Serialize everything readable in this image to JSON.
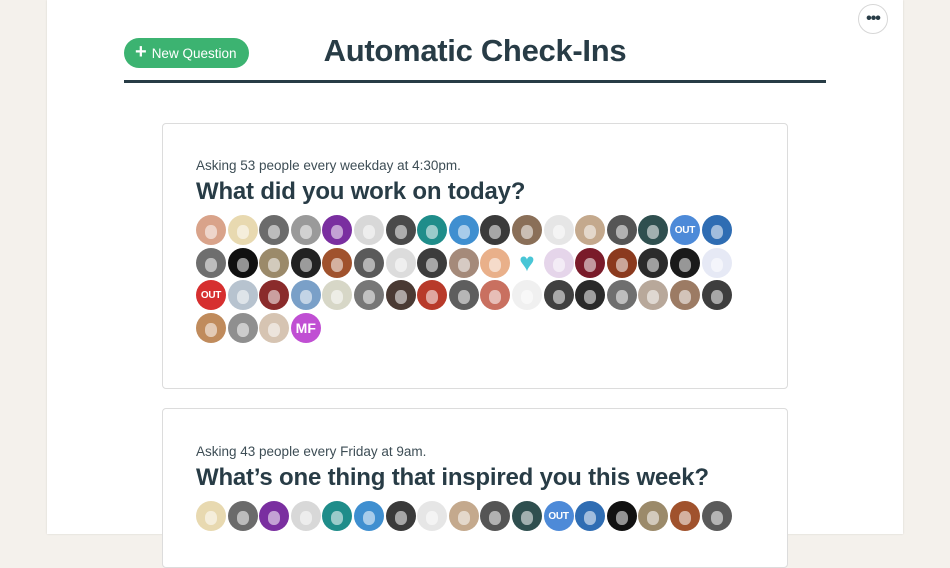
{
  "page": {
    "title": "Automatic Check-Ins",
    "new_question_label": "New Question",
    "more_label": "•••"
  },
  "colors": {
    "accent_green": "#3cb371",
    "title_ink": "#283c46",
    "initials_purple": "#c04fd3"
  },
  "checkins": [
    {
      "asking": "Asking 53 people every weekday at 4:30pm.",
      "question": "What did you work on today?",
      "avatars": [
        {
          "kind": "photo",
          "color": "#d9a38a"
        },
        {
          "kind": "photo",
          "color": "#e8d9b0"
        },
        {
          "kind": "photo",
          "color": "#6b6b6b"
        },
        {
          "kind": "photo",
          "color": "#9a9a9a"
        },
        {
          "kind": "photo",
          "color": "#7a2fa0"
        },
        {
          "kind": "photo",
          "color": "#d8d8d8"
        },
        {
          "kind": "photo",
          "color": "#4a4a4a"
        },
        {
          "kind": "photo",
          "color": "#1f8d8a"
        },
        {
          "kind": "photo",
          "color": "#3f8fd0"
        },
        {
          "kind": "photo",
          "color": "#3a3a3a"
        },
        {
          "kind": "photo",
          "color": "#8a6f58"
        },
        {
          "kind": "photo",
          "color": "#e6e6e6"
        },
        {
          "kind": "photo",
          "color": "#c4a98d"
        },
        {
          "kind": "photo",
          "color": "#555555"
        },
        {
          "kind": "photo",
          "color": "#2f4f4f"
        },
        {
          "kind": "out",
          "color": "#4d8ad8",
          "label": "OUT"
        },
        {
          "kind": "photo",
          "color": "#2f6db3"
        },
        {
          "kind": "photo",
          "color": "#6e6e6e"
        },
        {
          "kind": "photo",
          "color": "#111111"
        },
        {
          "kind": "photo",
          "color": "#9b8a6a"
        },
        {
          "kind": "photo",
          "color": "#222222"
        },
        {
          "kind": "photo",
          "color": "#a0522d"
        },
        {
          "kind": "photo",
          "color": "#5a5a5a"
        },
        {
          "kind": "photo",
          "color": "#dcdcdc"
        },
        {
          "kind": "photo",
          "color": "#3c3c3c"
        },
        {
          "kind": "photo",
          "color": "#a58a7a"
        },
        {
          "kind": "photo",
          "color": "#e9b08a"
        },
        {
          "kind": "heart",
          "color": "#49c6d6",
          "label": "♥"
        },
        {
          "kind": "photo",
          "color": "#e5d5ea"
        },
        {
          "kind": "photo",
          "color": "#7a1b2a"
        },
        {
          "kind": "photo",
          "color": "#8b3a1e"
        },
        {
          "kind": "photo",
          "color": "#2b2b2b"
        },
        {
          "kind": "photo",
          "color": "#1a1a1a"
        },
        {
          "kind": "photo",
          "color": "#e6e9f5"
        },
        {
          "kind": "out",
          "color": "#d62f2f",
          "label": "OUT"
        },
        {
          "kind": "photo",
          "color": "#b7c3cf"
        },
        {
          "kind": "photo",
          "color": "#8a2b2b"
        },
        {
          "kind": "photo",
          "color": "#7aa0c8"
        },
        {
          "kind": "photo",
          "color": "#d7d7c7"
        },
        {
          "kind": "photo",
          "color": "#777777"
        },
        {
          "kind": "photo",
          "color": "#4a3a33"
        },
        {
          "kind": "photo",
          "color": "#b83a2a"
        },
        {
          "kind": "photo",
          "color": "#5e5e5e"
        },
        {
          "kind": "photo",
          "color": "#c97060"
        },
        {
          "kind": "photo",
          "color": "#f0f0f0"
        },
        {
          "kind": "photo",
          "color": "#404040"
        },
        {
          "kind": "photo",
          "color": "#2a2a2a"
        },
        {
          "kind": "photo",
          "color": "#6f6f6f"
        },
        {
          "kind": "photo",
          "color": "#b8a89a"
        },
        {
          "kind": "photo",
          "color": "#9c7b64"
        },
        {
          "kind": "photo",
          "color": "#3e3e3e"
        },
        {
          "kind": "photo",
          "color": "#c08b5c"
        },
        {
          "kind": "photo",
          "color": "#8f8f8f"
        },
        {
          "kind": "photo",
          "color": "#d6c4b2"
        },
        {
          "kind": "initials",
          "color": "#c04fd3",
          "label": "MF"
        }
      ]
    },
    {
      "asking": "Asking 43 people every Friday at 9am.",
      "question": "What’s one thing that inspired you this week?",
      "avatars": [
        {
          "kind": "photo",
          "color": "#e8d9b0"
        },
        {
          "kind": "photo",
          "color": "#6b6b6b"
        },
        {
          "kind": "photo",
          "color": "#7a2fa0"
        },
        {
          "kind": "photo",
          "color": "#d8d8d8"
        },
        {
          "kind": "photo",
          "color": "#1f8d8a"
        },
        {
          "kind": "photo",
          "color": "#3f8fd0"
        },
        {
          "kind": "photo",
          "color": "#3a3a3a"
        },
        {
          "kind": "photo",
          "color": "#e6e6e6"
        },
        {
          "kind": "photo",
          "color": "#c4a98d"
        },
        {
          "kind": "photo",
          "color": "#555555"
        },
        {
          "kind": "photo",
          "color": "#2f4f4f"
        },
        {
          "kind": "out",
          "color": "#4d8ad8",
          "label": "OUT"
        },
        {
          "kind": "photo",
          "color": "#2f6db3"
        },
        {
          "kind": "photo",
          "color": "#111111"
        },
        {
          "kind": "photo",
          "color": "#9b8a6a"
        },
        {
          "kind": "photo",
          "color": "#a0522d"
        },
        {
          "kind": "photo",
          "color": "#5a5a5a"
        }
      ]
    }
  ]
}
